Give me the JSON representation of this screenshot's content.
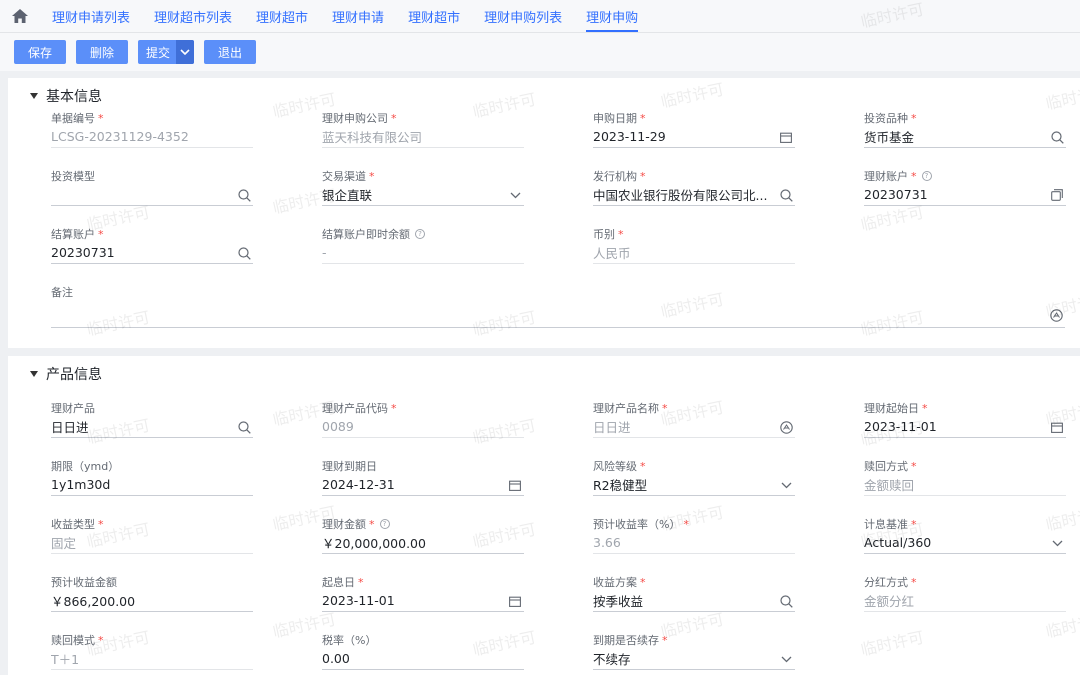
{
  "tabs": [
    "理财申请列表",
    "理财超市列表",
    "理财超市",
    "理财申请",
    "理财超市",
    "理财申购列表",
    "理财申购"
  ],
  "toolbar": {
    "save": "保存",
    "delete": "删除",
    "submit": "提交",
    "exit": "退出"
  },
  "watermark": "临时许可",
  "basic": {
    "title": "基本信息",
    "fields": {
      "doc_no": {
        "label": "单据编号",
        "value": "LCSG-20231129-4352"
      },
      "company": {
        "label": "理财申购公司",
        "value": "蓝天科技有限公司"
      },
      "date": {
        "label": "申购日期",
        "value": "2023-11-29"
      },
      "variety": {
        "label": "投资品种",
        "value": "货币基金"
      },
      "model": {
        "label": "投资模型",
        "value": ""
      },
      "channel": {
        "label": "交易渠道",
        "value": "银企直联"
      },
      "issuer": {
        "label": "发行机构",
        "value": "中国农业银行股份有限公司北..."
      },
      "account": {
        "label": "理财账户",
        "value": "20230731"
      },
      "settle": {
        "label": "结算账户",
        "value": "20230731"
      },
      "balance": {
        "label": "结算账户即时余额",
        "value": "-"
      },
      "currency": {
        "label": "币别",
        "value": "人民币"
      },
      "remark": {
        "label": "备注",
        "value": ""
      }
    }
  },
  "product": {
    "title": "产品信息",
    "fields": {
      "prod": {
        "label": "理财产品",
        "value": "日日进"
      },
      "code": {
        "label": "理财产品代码",
        "value": "0089"
      },
      "name": {
        "label": "理财产品名称",
        "value": "日日进"
      },
      "start": {
        "label": "理财起始日",
        "value": "2023-11-01"
      },
      "term": {
        "label": "期限（ymd）",
        "value": "1y1m30d"
      },
      "maturity": {
        "label": "理财到期日",
        "value": "2024-12-31"
      },
      "risk": {
        "label": "风险等级",
        "value": "R2稳健型"
      },
      "redeem_way": {
        "label": "赎回方式",
        "value": "金额赎回"
      },
      "income_type": {
        "label": "收益类型",
        "value": "固定"
      },
      "amount": {
        "label": "理财金额",
        "value": "￥20,000,000.00"
      },
      "rate": {
        "label": "预计收益率（%）",
        "value": "3.66"
      },
      "basis": {
        "label": "计息基准",
        "value": "Actual/360"
      },
      "est_income": {
        "label": "预计收益金额",
        "value": "￥866,200.00"
      },
      "value_date": {
        "label": "起息日",
        "value": "2023-11-01"
      },
      "scheme": {
        "label": "收益方案",
        "value": "按季收益"
      },
      "dividend": {
        "label": "分红方式",
        "value": "金额分红"
      },
      "redeem_mode": {
        "label": "赎回模式",
        "value": "T＋1"
      },
      "tax": {
        "label": "税率（%）",
        "value": "0.00"
      },
      "renew": {
        "label": "到期是否续存",
        "value": "不续存"
      }
    }
  }
}
